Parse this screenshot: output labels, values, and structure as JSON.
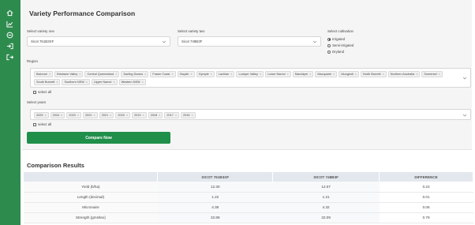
{
  "page_title": "Variety Performance Comparison",
  "variety_one": {
    "label": "Select variety one",
    "value": "Sicot 761B3XF"
  },
  "variety_two": {
    "label": "Select variety two",
    "value": "Sicot 748B3F"
  },
  "cultivation": {
    "label": "Select cultivation",
    "options": [
      {
        "label": "Irrigated",
        "selected": true
      },
      {
        "label": "Semi-irrigated",
        "selected": false
      },
      {
        "label": "Dryland",
        "selected": false
      }
    ]
  },
  "region": {
    "label": "Region",
    "chips": [
      "Balonne",
      "Brisbane Valley",
      "Central Queensland",
      "Darling Downs",
      "Fraser Coast",
      "Gwydir",
      "Gympie",
      "Lachlan",
      "Lockyer Valley",
      "Lower Namoi",
      "Macintyre",
      "Macquarie",
      "Mungindi",
      "North Burnett",
      "Northern Australia",
      "Somerset",
      "South Burnett",
      "Southern NSW",
      "Upper Namoi",
      "Western NSW"
    ],
    "select_all": "select all"
  },
  "years": {
    "label": "Select years",
    "chips": [
      "2025",
      "2024",
      "2023",
      "2022",
      "2021",
      "2020",
      "2019",
      "2018",
      "2017",
      "2016"
    ],
    "select_all": "select all"
  },
  "compare_button": "Compare Now",
  "results": {
    "title": "Comparison Results",
    "headers": [
      "",
      "SICOT 761B3XF",
      "SICOT 748B3F",
      "DIFFERENCE"
    ],
    "rows": [
      [
        "Yield (b/ha)",
        "12.30",
        "12.07",
        "0.23"
      ],
      [
        "Length (decimal)",
        "1.22",
        "1.21",
        "0.01"
      ],
      [
        "Micronaire",
        "4.38",
        "4.32",
        "0.06"
      ],
      [
        "Strength (gms/tex)",
        "32.88",
        "32.09",
        "0.79"
      ]
    ]
  },
  "icons": [
    "home-icon",
    "chart-icon",
    "compare-icon",
    "login-icon",
    "logout-icon"
  ],
  "colors": {
    "sidebar": "#2e8b4e",
    "button": "#1f8f4a",
    "table_header": "#e3e8ee"
  }
}
